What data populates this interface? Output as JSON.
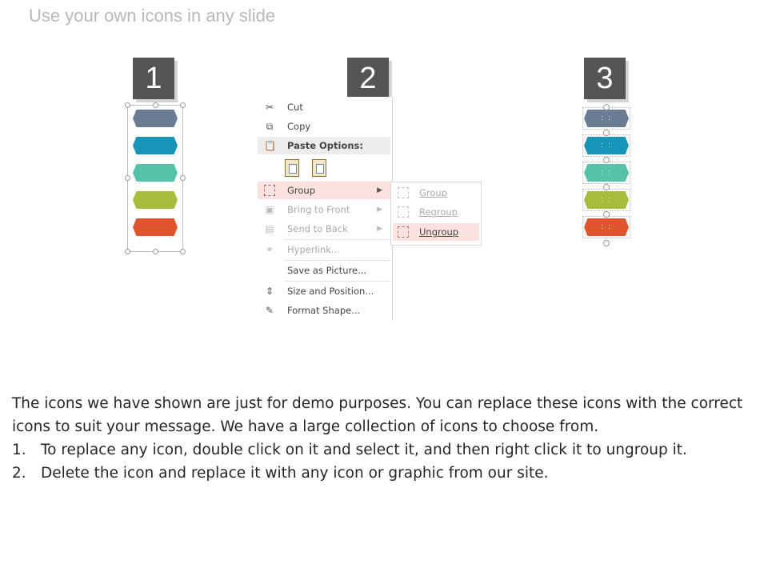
{
  "slide": {
    "title": "Use your own icons in any slide"
  },
  "steps": [
    "1",
    "2",
    "3"
  ],
  "colors": {
    "bar_1": "#6b7d94",
    "bar_2": "#1795b9",
    "bar_3": "#55c3a7",
    "bar_4": "#a9bd3d",
    "bar_5": "#e0552e",
    "badge": "#555555",
    "highlight": "#fbe2df"
  },
  "context_menu": {
    "cut": "Cut",
    "copy": "Copy",
    "paste_options": "Paste Options:",
    "group": "Group",
    "bring_to_front": "Bring to Front",
    "send_to_back": "Send to Back",
    "hyperlink": "Hyperlink...",
    "save_as_picture": "Save as Picture...",
    "size_and_position": "Size and Position...",
    "format_shape": "Format Shape..."
  },
  "submenu": {
    "group": "Group",
    "regroup": "Regroup",
    "ungroup": "Ungroup"
  },
  "body": {
    "intro": "The icons we have shown are just for demo purposes. You can replace these icons with the correct icons to suit your message. We have a large collection of icons to choose from.",
    "items": [
      {
        "num": "1.",
        "text": "To replace any icon, double click on it and select it, and then right click it to ungroup it."
      },
      {
        "num": "2.",
        "text": "Delete the icon and replace it with any icon or graphic from our site."
      }
    ]
  }
}
